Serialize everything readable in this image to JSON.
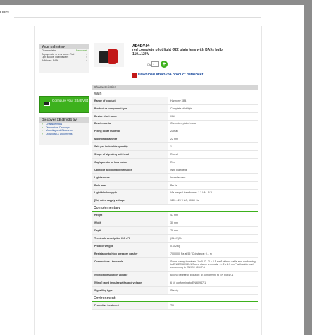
{
  "links_tab": "Links",
  "selection": {
    "title": "Your selection",
    "characteristics_label": "Characteristics",
    "remove_all": "Remove all",
    "items": [
      "Cap/operator or lens colour: Red",
      "Light source: Incandescent",
      "Bulb base: BA 9s"
    ]
  },
  "configure": {
    "label": "Configure your XB4BV34"
  },
  "discover": {
    "title": "Discover XB4BV34 by",
    "links": [
      "Characteristics",
      "Dimensions Drawings",
      "Mounting and Clearance",
      "Download & Documents"
    ]
  },
  "product": {
    "reference": "XB4BV34",
    "description": "red complete pilot light Ø22 plain lens with BA9s bulb 110...120V",
    "qty_label": "Qty",
    "qty_value": "1",
    "go_label": "+",
    "datasheet": "Download XB4BV34 product datasheet"
  },
  "characteristics": {
    "title": "Characteristics",
    "sections": [
      {
        "title": "Main",
        "rows": [
          [
            "Range of product",
            "Harmony XB4"
          ],
          [
            "Product or component type",
            "Complete pilot light"
          ],
          [
            "Device short name",
            "XB4"
          ],
          [
            "Bezel material",
            "Chromium plated metal"
          ],
          [
            "Fixing collar material",
            "Zamak"
          ],
          [
            "Mounting diameter",
            "22 mm"
          ],
          [
            "Sale per indivisible quantity",
            "1"
          ],
          [
            "Shape of signaling unit head",
            "Round"
          ],
          [
            "Cap/operator or lens colour",
            "Red"
          ],
          [
            "Operator additional information",
            "With plain lens"
          ],
          [
            "Light source",
            "Incandescent"
          ],
          [
            "Bulb base",
            "BA 9s"
          ],
          [
            "Light block supply",
            "Via integral transformer: 1.2 VA – 6 V"
          ],
          [
            "[Us] rated supply voltage",
            "110...120 V AC, 50/60 Hz"
          ]
        ]
      },
      {
        "title": "Complementary",
        "rows": [
          [
            "Height",
            "47 mm"
          ],
          [
            "Width",
            "30 mm"
          ],
          [
            "Depth",
            "78 mm"
          ],
          [
            "Terminals description ISO n°1",
            "(01-X2)PL"
          ],
          [
            "Product weight",
            "0.102 kg"
          ],
          [
            "Resistance to high pressure washer",
            "7000000 Pa at 55 °C distance: 0.1 m"
          ],
          [
            "Connections - terminals",
            "Screw clamp terminals: 1 x 0.22...2 x 2.5 mm² without cable end conforming to EN/IEC 60947-1 Screw clamp terminals: <= 2 x 1.5 mm² with cable end conforming to EN/IEC 60947-1"
          ],
          [
            "[Ui] rated insulation voltage",
            "600 V (degree of pollution: 3) conforming to EN 60947-1"
          ],
          [
            "[Uimp] rated impulse withstand voltage",
            "6 kV conforming to EN 60947-1"
          ],
          [
            "Signalling type",
            "Steady"
          ]
        ]
      },
      {
        "title": "Environment",
        "rows": [
          [
            "Protective treatment",
            "TH"
          ]
        ]
      }
    ]
  }
}
